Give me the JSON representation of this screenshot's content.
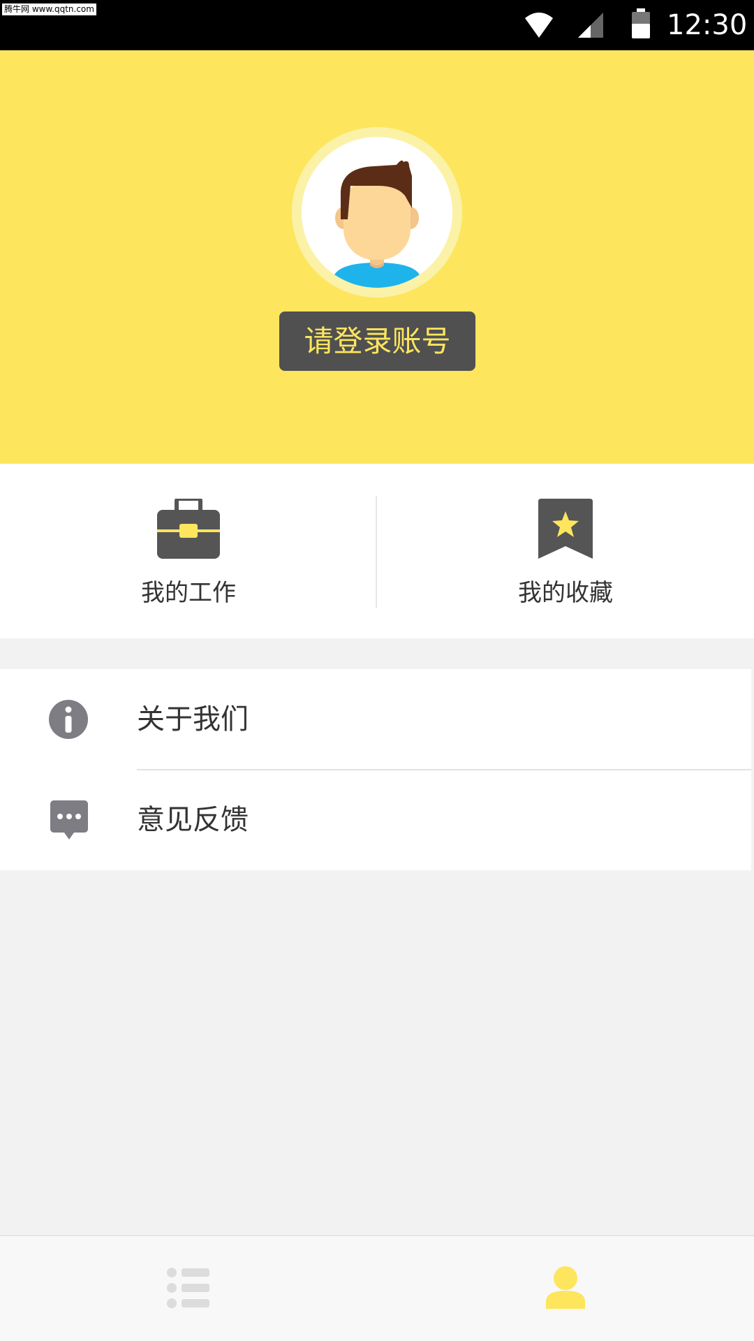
{
  "status_bar": {
    "watermark": "腾牛网 www.qqtn.com",
    "time": "12:30",
    "icons": [
      "wifi-icon",
      "cell-signal-icon",
      "battery-icon"
    ]
  },
  "header": {
    "background_color": "#fde55e",
    "avatar_icon": "default-avatar",
    "login_button_label": "请登录账号"
  },
  "shortcuts": [
    {
      "label": "我的工作",
      "icon": "briefcase-icon"
    },
    {
      "label": "我的收藏",
      "icon": "bookmark-star-icon"
    }
  ],
  "menu": [
    {
      "label": "关于我们",
      "icon": "info-icon"
    },
    {
      "label": "意见反馈",
      "icon": "chat-feedback-icon"
    }
  ],
  "bottom_nav": {
    "tabs": [
      {
        "icon": "list-icon",
        "active": false
      },
      {
        "icon": "profile-icon",
        "active": true
      }
    ],
    "active_color": "#fde55e"
  }
}
